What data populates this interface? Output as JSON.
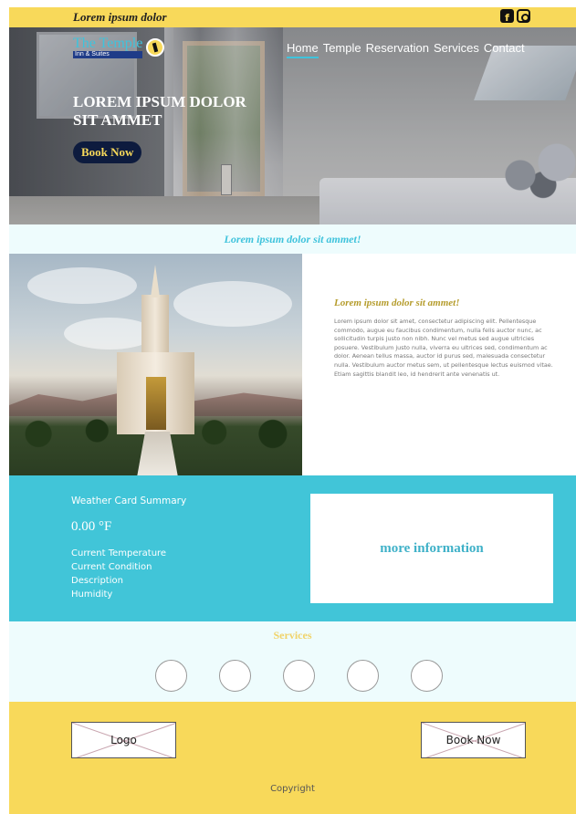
{
  "topbar": {
    "brand": "Lorem ipsum dolor",
    "social": [
      {
        "icon": "facebook-icon",
        "glyph": "f"
      },
      {
        "icon": "instagram-icon",
        "glyph": ""
      }
    ]
  },
  "header": {
    "logo_title": "The Temple",
    "logo_sub": "Inn & Suites",
    "nav": [
      "Home",
      "Temple",
      "Reservation",
      "Services",
      "Contact"
    ],
    "active_nav": "Home"
  },
  "hero": {
    "title": "LOREM IPSUM DOLOR SIT AMMET",
    "button_label": "Book Now"
  },
  "tagline": "Lorem ipsum dolor sit ammet!",
  "feature": {
    "heading": "Lorem ipsum dolor sit ammet!",
    "body": "Lorem ipsum dolor sit amet, consectetur adipiscing elit. Pellentesque commodo, augue eu faucibus condimentum, nulla felis auctor nunc, ac sollicitudin turpis justo non nibh. Nunc vel metus sed augue ultricies posuere. Vestibulum justo nulla, viverra eu ultrices sed, condimentum ac dolor. Aenean tellus massa, auctor id purus sed, malesuada consectetur nulla. Vestibulum auctor metus sem, ut pellentesque lectus euismod vitae. Etiam sagittis blandit leo, id hendrerit ante venenatis ut."
  },
  "weather": {
    "title": "Weather Card Summary",
    "temperature": "0.00 °F",
    "fields": [
      "Current Temperature",
      "Current Condition",
      "Description",
      "Humidity"
    ],
    "more_info": "more information"
  },
  "services": {
    "title": "Services",
    "count": 5
  },
  "footer": {
    "logo_label": "Logo",
    "book_label": "Book Now",
    "copyright": "Copyright"
  },
  "colors": {
    "accent_yellow": "#f8d95a",
    "accent_cyan": "#41c5d8",
    "navy": "#0d1b3e"
  }
}
